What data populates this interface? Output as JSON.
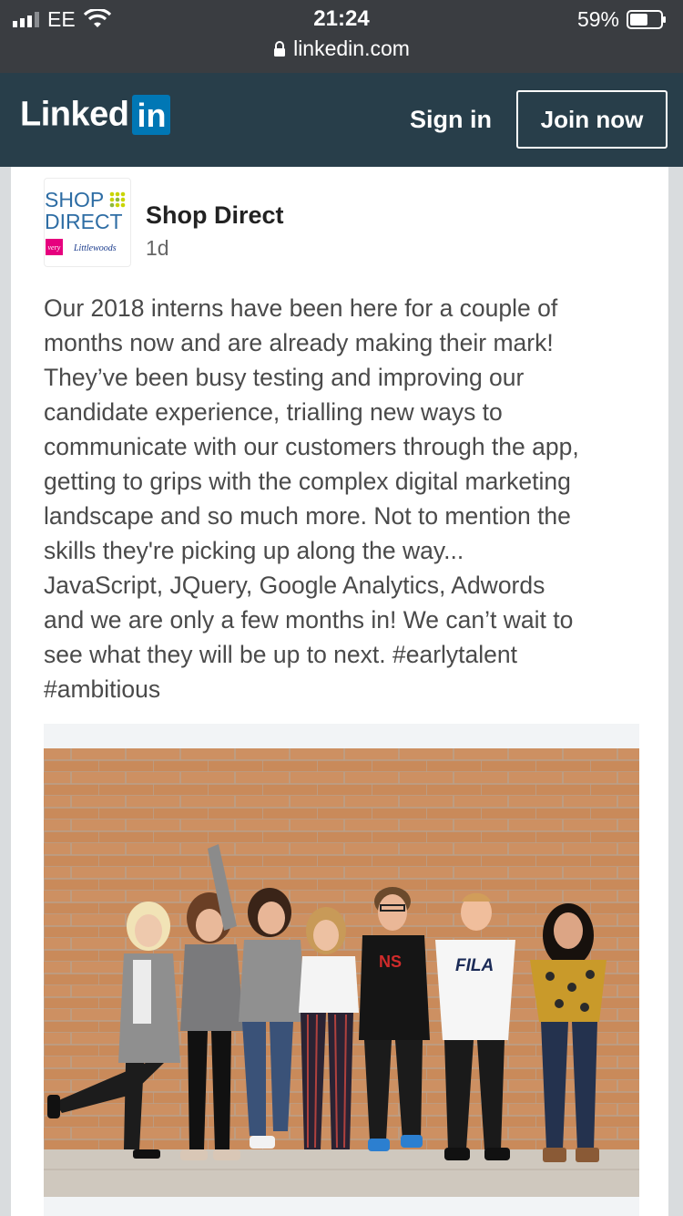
{
  "status_bar": {
    "carrier": "EE",
    "time": "21:24",
    "battery_percent": "59%",
    "battery_level": 0.59,
    "url": "linkedin.com"
  },
  "header": {
    "logo_text": "Linked",
    "logo_badge": "in",
    "sign_in_label": "Sign in",
    "join_now_label": "Join now"
  },
  "post": {
    "company_name": "Shop Direct",
    "time_ago": "1d",
    "logo_brand_top": "SHOP",
    "logo_brand_bottom": "DIRECT",
    "logo_sub_left": "very",
    "logo_sub_right": "Littlewoods",
    "text": "Our 2018 interns have been here for a couple of\nmonths now and are already making their mark!\nThey’ve been busy testing and improving our\ncandidate experience, trialling new ways to\ncommunicate with our customers through the app,\ngetting to grips with the complex digital marketing\nlandscape and so much more. Not to mention the\nskills they're picking up along the way...\nJavaScript, JQuery, Google Analytics, Adwords\nand we are only a few months in! We can’t wait to\nsee what they will be up to next. #earlytalent\n#ambitious",
    "photo_shirt_text_1": "NS",
    "photo_shirt_text_2": "FILA"
  },
  "colors": {
    "status_bg": "#3a3d41",
    "header_bg": "#283e4a",
    "linkedin_blue": "#0077b5",
    "brick": "#c98a5a",
    "very_pink": "#e6007e",
    "shop_direct_blue": "#2e6da4",
    "shop_direct_green": "#c8d400"
  }
}
